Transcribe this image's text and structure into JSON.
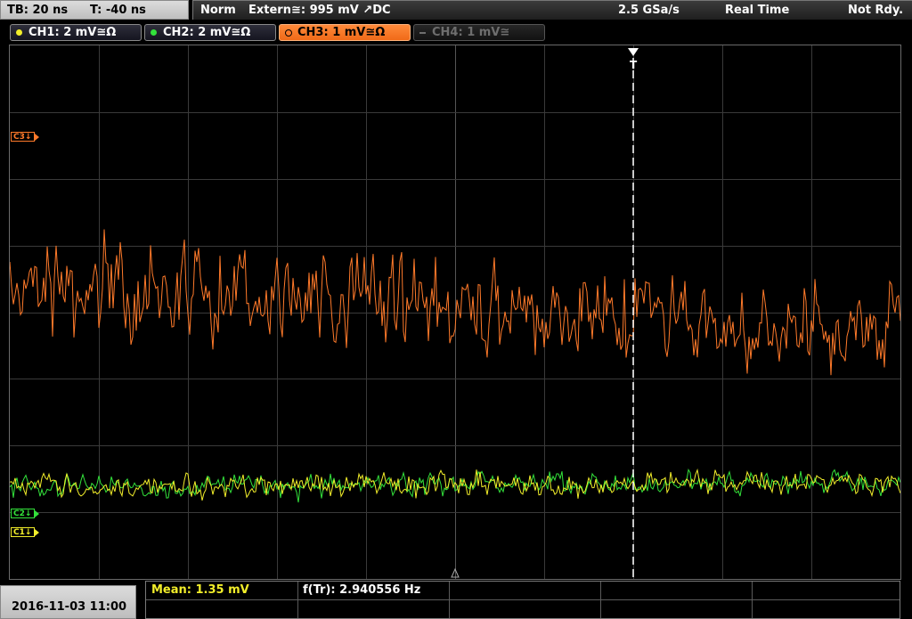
{
  "status": {
    "timebase": "TB: 20 ns",
    "trigger_time": "T: -40 ns",
    "mode": "Norm",
    "trigger_source": "Extern≅: 995 mV ↗DC",
    "sample_rate": "2.5 GSa/s",
    "acquisition": "Real Time",
    "ready_state": "Not Rdy."
  },
  "channels": [
    {
      "label": "CH1: 2 mV≅Ω",
      "color": "#f2ee2a",
      "active": true
    },
    {
      "label": "CH2: 2 mV≅Ω",
      "color": "#33e23b",
      "active": true
    },
    {
      "label": "CH3: 1 mV≅Ω",
      "color": "#ff7a2a",
      "active": true,
      "selected": true
    },
    {
      "label": "CH4: 1 mV≅",
      "color": "#6e6e6e",
      "active": false
    }
  ],
  "markers": {
    "ch3": "C3",
    "ch2": "C2",
    "ch1": "C1",
    "trigger": "T"
  },
  "measurements": {
    "mean": "Mean: 1.35 mV",
    "frequency": "f(Tr): 2.940556 Hz"
  },
  "datetime": "2016-11-03 11:00",
  "colors": {
    "ch1": "#f2ee2a",
    "ch2": "#33e23b",
    "ch3": "#ff7a2a",
    "grid": "#3a3a3a"
  }
}
